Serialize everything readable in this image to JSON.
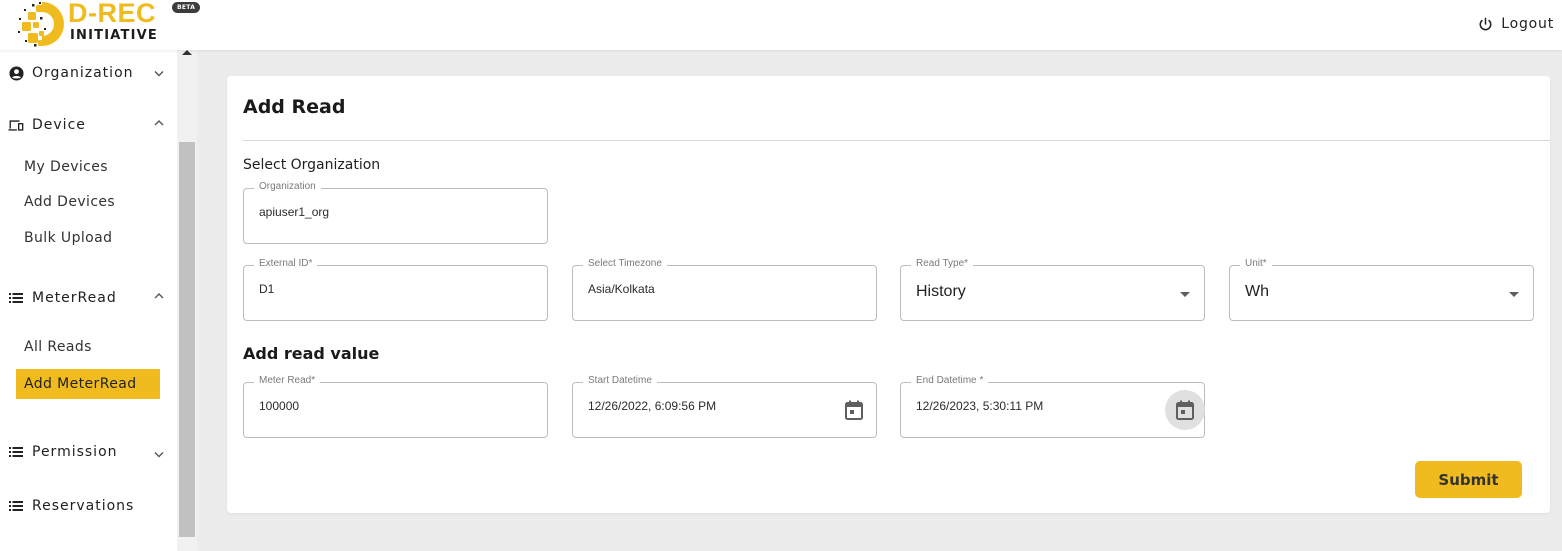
{
  "header": {
    "logo_title": "D-REC",
    "logo_subtitle": "INITIATIVE",
    "beta_badge": "BETA",
    "logout_label": "Logout",
    "brand_color": "#f0bb1e"
  },
  "sidebar": {
    "groups": [
      {
        "label": "Organization",
        "icon": "account-circle-icon",
        "expanded": false,
        "items": []
      },
      {
        "label": "Device",
        "icon": "devices-icon",
        "expanded": true,
        "items": [
          {
            "label": "My Devices",
            "active": false
          },
          {
            "label": "Add Devices",
            "active": false
          },
          {
            "label": "Bulk Upload",
            "active": false
          }
        ]
      },
      {
        "label": "MeterRead",
        "icon": "list-icon",
        "expanded": true,
        "items": [
          {
            "label": "All Reads",
            "active": false
          },
          {
            "label": "Add MeterRead",
            "active": true
          }
        ]
      },
      {
        "label": "Permission",
        "icon": "list-icon",
        "expanded": false,
        "items": []
      },
      {
        "label": "Reservations",
        "icon": "list-icon",
        "expanded": false,
        "items": []
      }
    ]
  },
  "form": {
    "title": "Add Read",
    "select_org_label": "Select Organization",
    "organization": {
      "label": "Organization",
      "value": "apiuser1_org"
    },
    "external_id": {
      "label": "External ID*",
      "value": "D1"
    },
    "timezone": {
      "label": "Select Timezone",
      "value": "Asia/Kolkata"
    },
    "read_type": {
      "label": "Read Type*",
      "value": "History"
    },
    "unit": {
      "label": "Unit*",
      "value": "Wh"
    },
    "read_value_heading": "Add read value",
    "meter_read": {
      "label": "Meter Read*",
      "value": "100000"
    },
    "start_datetime": {
      "label": "Start Datetime",
      "value": "12/26/2022, 6:09:56 PM"
    },
    "end_datetime": {
      "label": "End Datetime *",
      "value": "12/26/2023, 5:30:11 PM"
    },
    "submit_label": "Submit"
  }
}
